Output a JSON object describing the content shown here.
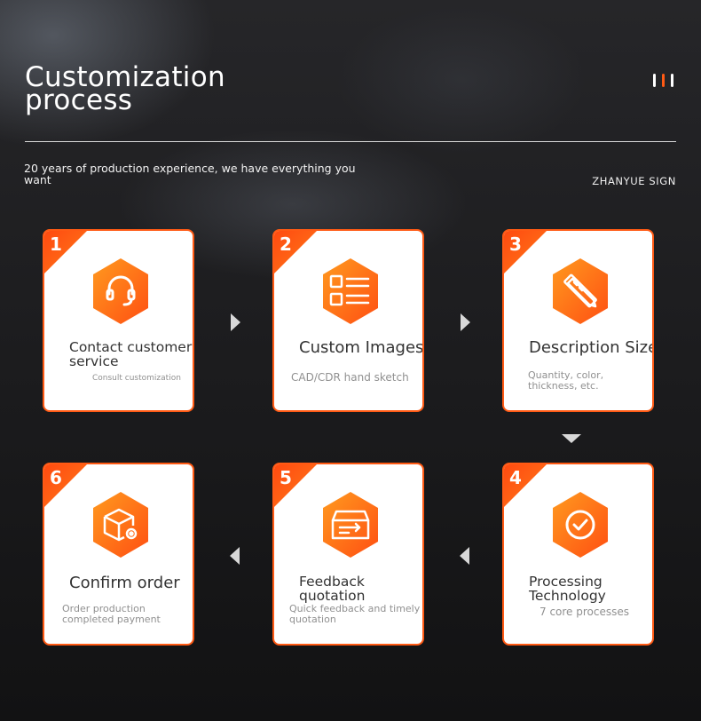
{
  "header": {
    "title_line1": "Customization",
    "title_line2": "process",
    "subtitle": "20 years of production experience, we have everything you want",
    "brand": "ZHANYUE SIGN"
  },
  "colors": {
    "accent": "#ff5a14",
    "accent_light": "#ff8c1a",
    "background": "#1b1b1d"
  },
  "steps": [
    {
      "number": "1",
      "title": "Contact customer service",
      "description": "Consult customization",
      "icon": "headset-icon"
    },
    {
      "number": "2",
      "title": "Custom Images",
      "description": "CAD/CDR hand sketch",
      "icon": "list-icon"
    },
    {
      "number": "3",
      "title": "Description Size",
      "description": "Quantity, color, thickness, etc.",
      "icon": "pencil-ruler-icon"
    },
    {
      "number": "4",
      "title": "Processing Technology",
      "description": "7 core processes",
      "icon": "check-circle-icon"
    },
    {
      "number": "5",
      "title": "Feedback quotation",
      "description": "Quick feedback and timely quotation",
      "icon": "inbox-arrow-icon"
    },
    {
      "number": "6",
      "title": "Confirm order",
      "description": "Order production completed payment",
      "icon": "box-gear-icon"
    }
  ]
}
